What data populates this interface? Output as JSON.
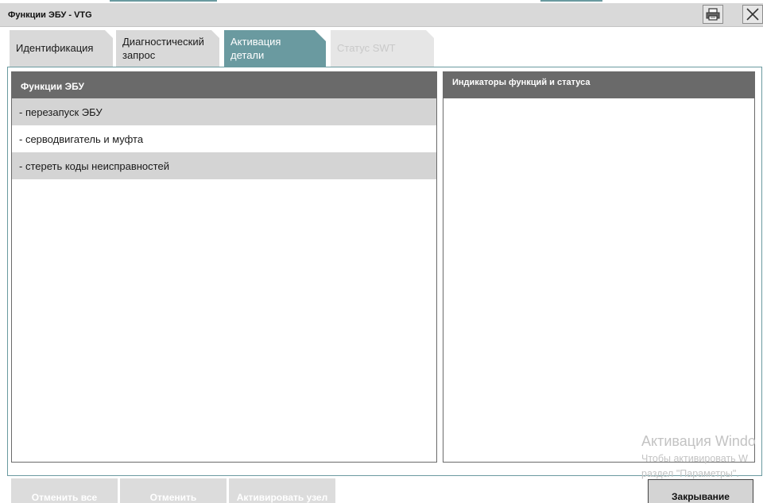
{
  "window": {
    "title": "Функции ЭБУ - VTG"
  },
  "tabs": [
    {
      "label_line1": "Идентификация",
      "label_line2": "",
      "state": "normal"
    },
    {
      "label_line1": "Диагностический",
      "label_line2": "запрос",
      "state": "normal"
    },
    {
      "label_line1": "Активация",
      "label_line2": "детали",
      "state": "active"
    },
    {
      "label_line1": "Статус SWT",
      "label_line2": "",
      "state": "disabled"
    }
  ],
  "left_panel": {
    "header": "Функции ЭБУ",
    "items": [
      {
        "label": "- перезапуск ЭБУ"
      },
      {
        "label": "- серводвигатель и муфта"
      },
      {
        "label": "- стереть коды неисправностей"
      }
    ]
  },
  "right_panel": {
    "header": "Индикаторы функций и статуса"
  },
  "buttons": {
    "cancel_all": "Отменить все",
    "cancel": "Отменить",
    "activate_node": "Активировать узел",
    "close": "Закрывание"
  },
  "watermark": {
    "line1": "Активация Windo",
    "line2": "Чтобы активировать W",
    "line3": "раздел \"Параметры\"."
  },
  "colors": {
    "accent_teal": "#6a9aa0",
    "header_gray": "#6a6a6a",
    "row_alt_gray": "#d4d4d4",
    "titlebar_gray": "#d9d9d9"
  },
  "icons": [
    "printer-icon",
    "close-icon"
  ]
}
